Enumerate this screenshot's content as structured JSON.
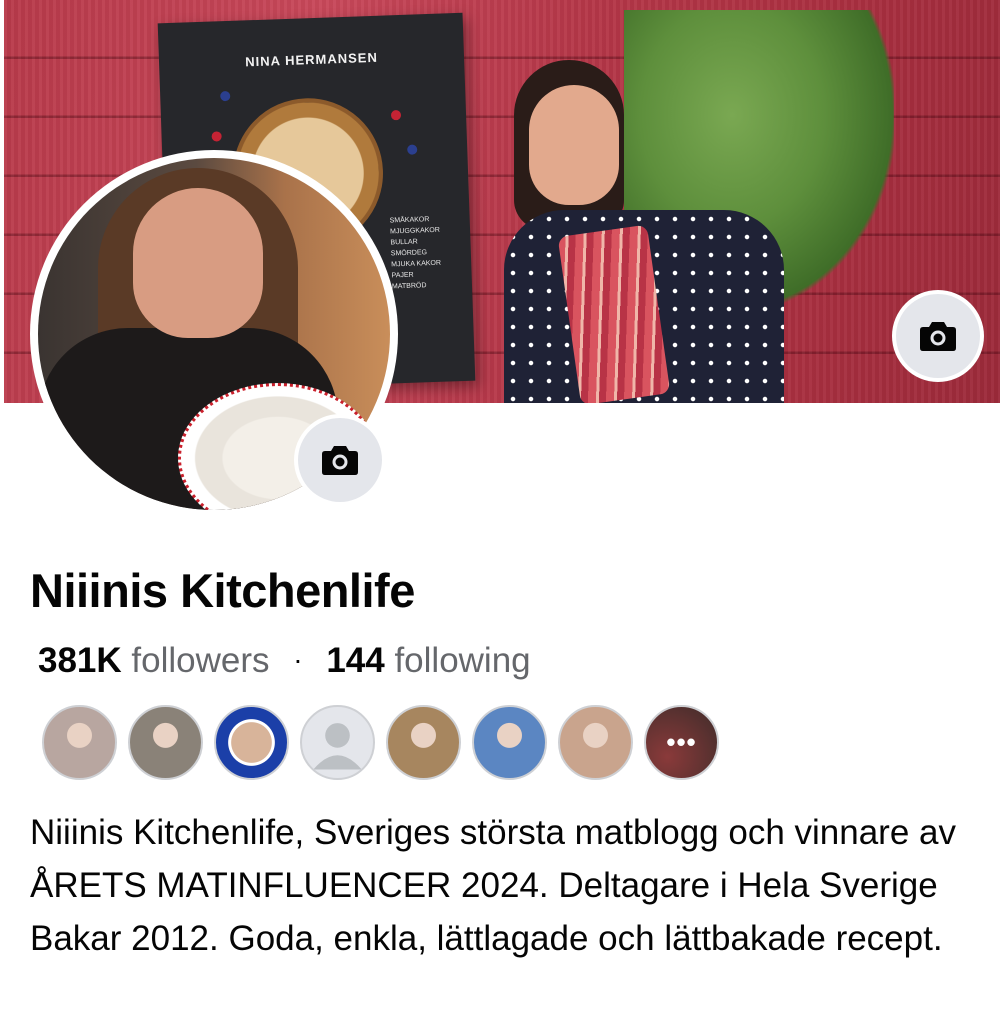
{
  "cover": {
    "book_author": "NINA HERMANSEN",
    "book_list": [
      "SMÅKAKOR",
      "MJUGGKAKOR",
      "BULLAR",
      "SMÖRDEG",
      "MJUKA KAKOR",
      "PAJER",
      "MATBRÖD"
    ],
    "camera_icon": "camera-icon"
  },
  "profile": {
    "name": "Niiinis Kitchenlife",
    "followers_count": "381K",
    "followers_label": "followers",
    "separator": "·",
    "following_count": "144",
    "following_label": "following",
    "avatar_camera_icon": "camera-icon"
  },
  "friends": {
    "items": [
      {
        "kind": "photo",
        "color": "#b8a6a0"
      },
      {
        "kind": "photo",
        "color": "#8a8278"
      },
      {
        "kind": "badge",
        "color": "#1b3fa8"
      },
      {
        "kind": "default-avatar",
        "color": "#bcc0c4"
      },
      {
        "kind": "photo",
        "color": "#a7865f"
      },
      {
        "kind": "photo",
        "color": "#5b86c2"
      },
      {
        "kind": "photo",
        "color": "#c9a48d"
      },
      {
        "kind": "more",
        "color": "#3e2c2a",
        "label": "•••"
      }
    ]
  },
  "bio": {
    "text": "Niiinis Kitchenlife, Sveriges största matblogg och vinnare av ÅRETS MATINFLUENCER 2024. Deltagare i Hela Sverige Bakar 2012. Goda, enkla, lättlagade och lättbakade recept."
  },
  "colors": {
    "cover_red": "#b83a4a",
    "secondary_text": "#65676b",
    "button_gray": "#e4e6eb"
  }
}
